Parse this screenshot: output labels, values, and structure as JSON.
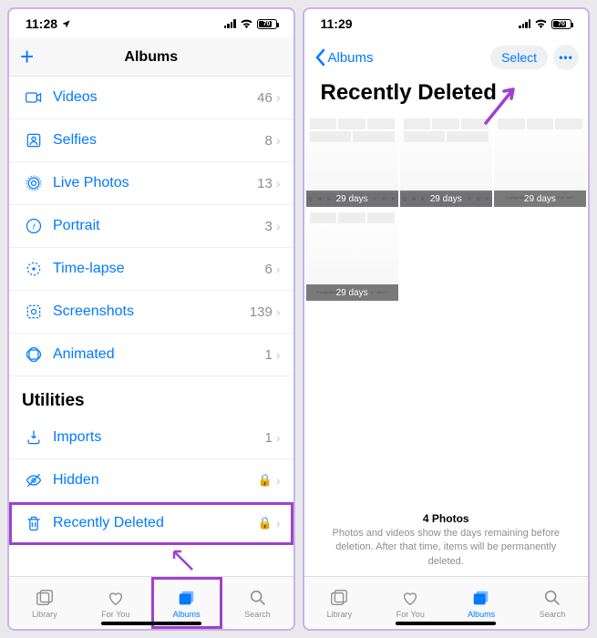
{
  "statusbar": {
    "time1": "11:28",
    "time2": "11:29",
    "battery": "70"
  },
  "screen1": {
    "nav_title": "Albums",
    "media_types": [
      {
        "icon": "video",
        "label": "Videos",
        "count": "46"
      },
      {
        "icon": "selfie",
        "label": "Selfies",
        "count": "8"
      },
      {
        "icon": "live",
        "label": "Live Photos",
        "count": "13"
      },
      {
        "icon": "portrait",
        "label": "Portrait",
        "count": "3"
      },
      {
        "icon": "timelapse",
        "label": "Time-lapse",
        "count": "6"
      },
      {
        "icon": "screenshot",
        "label": "Screenshots",
        "count": "139"
      },
      {
        "icon": "animated",
        "label": "Animated",
        "count": "1"
      }
    ],
    "utilities_title": "Utilities",
    "utilities": [
      {
        "icon": "import",
        "label": "Imports",
        "count": "1",
        "lock": false
      },
      {
        "icon": "hidden",
        "label": "Hidden",
        "count": "",
        "lock": true
      },
      {
        "icon": "trash",
        "label": "Recently Deleted",
        "count": "",
        "lock": true
      }
    ]
  },
  "screen2": {
    "back_label": "Albums",
    "select_label": "Select",
    "page_title": "Recently Deleted",
    "thumb_days": "29 days",
    "footer_count": "4 Photos",
    "footer_text": "Photos and videos show the days remaining before deletion. After that time, items will be permanently deleted."
  },
  "tabbar": {
    "library": "Library",
    "for_you": "For You",
    "albums": "Albums",
    "search": "Search"
  }
}
